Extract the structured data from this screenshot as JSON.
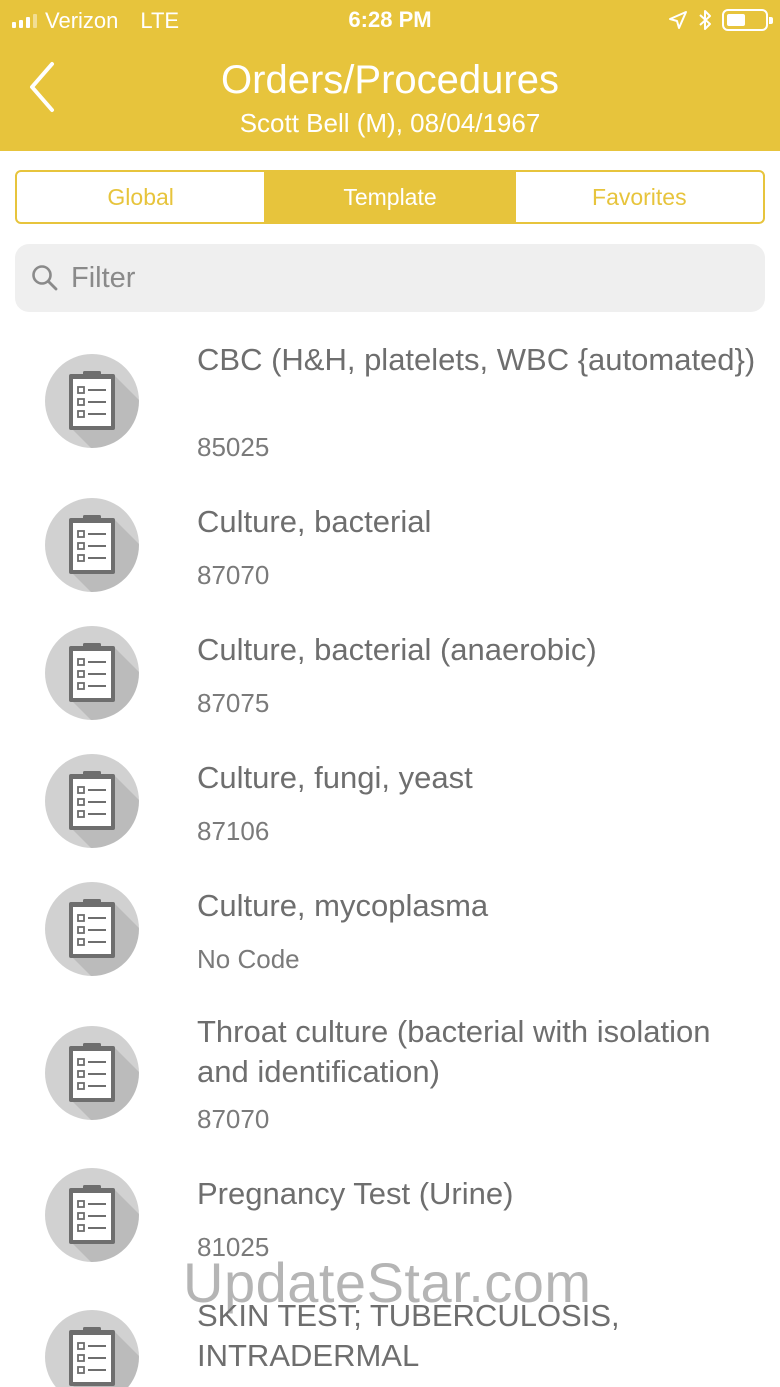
{
  "status_bar": {
    "carrier": "Verizon",
    "network": "LTE",
    "time": "6:28 PM"
  },
  "nav": {
    "title": "Orders/Procedures",
    "subtitle": "Scott Bell (M), 08/04/1967",
    "back_icon": "chevron-left-icon"
  },
  "tabs": [
    {
      "label": "Global",
      "selected": false
    },
    {
      "label": "Template",
      "selected": true
    },
    {
      "label": "Favorites",
      "selected": false
    }
  ],
  "search": {
    "placeholder": "Filter",
    "value": ""
  },
  "items": [
    {
      "title": "CBC (H&H, platelets, WBC {automated})",
      "code": "85025",
      "icon": "clipboard-checklist-icon"
    },
    {
      "title": "Culture, bacterial",
      "code": "87070",
      "icon": "clipboard-checklist-icon"
    },
    {
      "title": "Culture, bacterial (anaerobic)",
      "code": "87075",
      "icon": "clipboard-checklist-icon"
    },
    {
      "title": "Culture, fungi, yeast",
      "code": "87106",
      "icon": "clipboard-checklist-icon"
    },
    {
      "title": "Culture, mycoplasma",
      "code": "No Code",
      "icon": "clipboard-checklist-icon"
    },
    {
      "title": "Throat culture (bacterial with isolation and identification)",
      "code": "87070",
      "icon": "clipboard-checklist-icon"
    },
    {
      "title": "Pregnancy Test (Urine)",
      "code": "81025",
      "icon": "clipboard-checklist-icon"
    },
    {
      "title": "SKIN TEST; TUBERCULOSIS, INTRADERMAL",
      "code": "",
      "icon": "clipboard-checklist-icon"
    }
  ],
  "watermark": "UpdateStar.com",
  "colors": {
    "accent": "#e7c43c",
    "icon_circle": "#d1d1d1",
    "text": "#6e6e6e"
  }
}
